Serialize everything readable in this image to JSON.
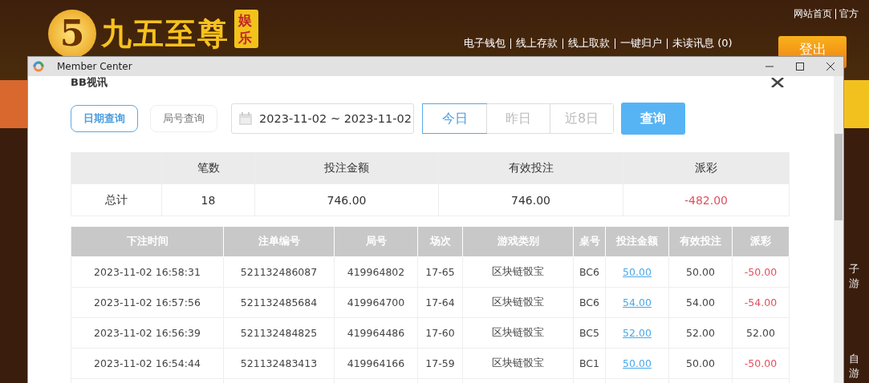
{
  "site": {
    "logo": {
      "digit": "5",
      "name": "九五至尊",
      "badge": "娱乐"
    },
    "top_links": [
      "网站首页",
      "官方"
    ],
    "nav": [
      "电子钱包",
      "线上存款",
      "线上取款",
      "一键归户",
      "未读讯息 (0)"
    ],
    "logout": "登出",
    "side_labels": [
      "子游",
      "自游"
    ]
  },
  "window": {
    "title": "Member Center"
  },
  "section_title": "BB视讯",
  "query_tabs": [
    {
      "label": "日期查询",
      "selected": true
    },
    {
      "label": "局号查询",
      "selected": false
    }
  ],
  "date_range": "2023-11-02 ~ 2023-11-02",
  "quick_ranges": [
    {
      "label": "今日",
      "selected": true
    },
    {
      "label": "昨日",
      "selected": false
    },
    {
      "label": "近8日",
      "selected": false
    }
  ],
  "query_button": "查询",
  "summary": {
    "columns": [
      "笔数",
      "投注金额",
      "有效投注",
      "派彩"
    ],
    "row": {
      "label": "总计",
      "count": "18",
      "bet": "746.00",
      "valid": "746.00",
      "payout": "-482.00",
      "negative": true
    }
  },
  "table": {
    "columns": [
      "下注时间",
      "注单编号",
      "局号",
      "场次",
      "游戏类别",
      "桌号",
      "投注金额",
      "有效投注",
      "派彩"
    ],
    "rows": [
      {
        "time": "2023-11-02 16:58:31",
        "order": "521132486087",
        "round": "419964802",
        "session": "17-65",
        "game": "区块链骰宝",
        "desk": "BC6",
        "bet": "50.00",
        "valid": "50.00",
        "payout": "-50.00",
        "negative": true
      },
      {
        "time": "2023-11-02 16:57:56",
        "order": "521132485684",
        "round": "419964700",
        "session": "17-64",
        "game": "区块链骰宝",
        "desk": "BC6",
        "bet": "54.00",
        "valid": "54.00",
        "payout": "-54.00",
        "negative": true
      },
      {
        "time": "2023-11-02 16:56:39",
        "order": "521132484825",
        "round": "419964486",
        "session": "17-60",
        "game": "区块链骰宝",
        "desk": "BC5",
        "bet": "52.00",
        "valid": "52.00",
        "payout": "52.00",
        "negative": false
      },
      {
        "time": "2023-11-02 16:54:44",
        "order": "521132483413",
        "round": "419964166",
        "session": "17-59",
        "game": "区块链骰宝",
        "desk": "BC1",
        "bet": "50.00",
        "valid": "50.00",
        "payout": "-50.00",
        "negative": true
      }
    ]
  }
}
